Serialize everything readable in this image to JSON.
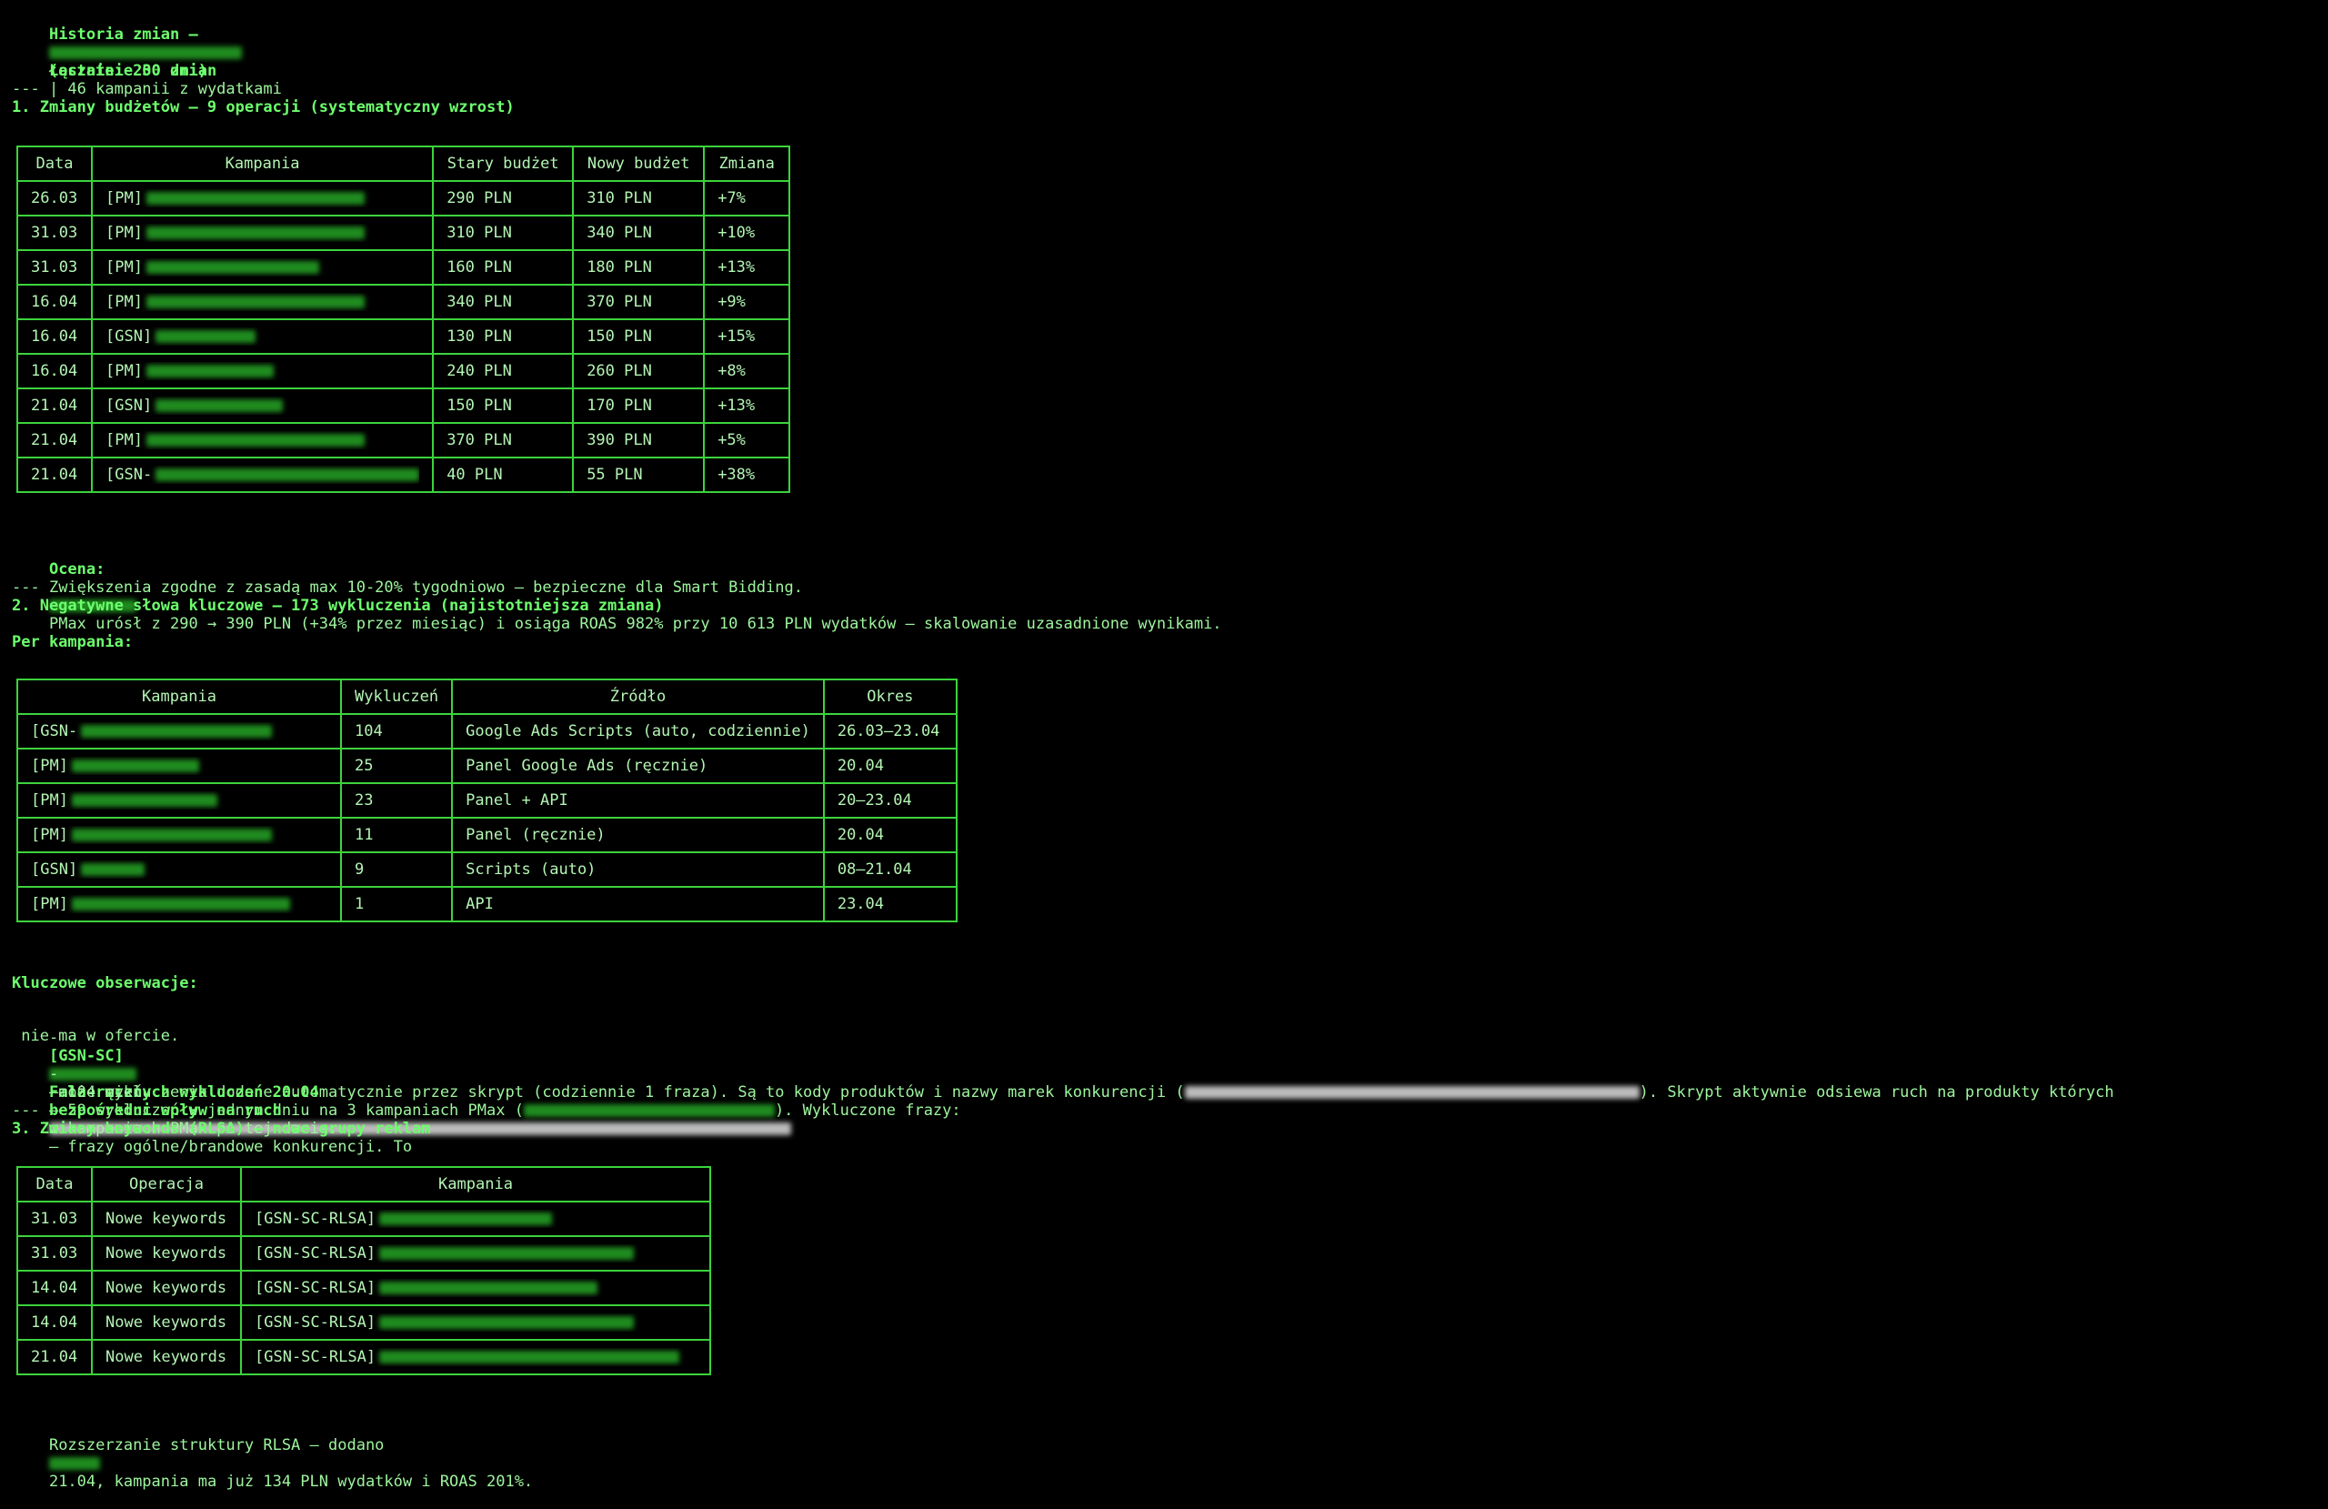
{
  "header": {
    "title_prefix": "Historia zmian —",
    "title_suffix": "(ostatnie 30 dni)",
    "total_label": "Łącznie: 200 zmian",
    "total_rest": "| 46 kampanii z wydatkami",
    "separator": "---"
  },
  "section1": {
    "heading": "1. Zmiany budżetów — 9 operacji (systematyczny wzrost)",
    "columns": [
      "Data",
      "Kampania",
      "Stary budżet",
      "Nowy budżet",
      "Zmiana"
    ],
    "rows": [
      {
        "date": "26.03",
        "prefix": "[PM]",
        "old": "290 PLN",
        "new": "310 PLN",
        "change": "+7%"
      },
      {
        "date": "31.03",
        "prefix": "[PM]",
        "old": "310 PLN",
        "new": "340 PLN",
        "change": "+10%"
      },
      {
        "date": "31.03",
        "prefix": "[PM]",
        "old": "160 PLN",
        "new": "180 PLN",
        "change": "+13%"
      },
      {
        "date": "16.04",
        "prefix": "[PM]",
        "old": "340 PLN",
        "new": "370 PLN",
        "change": "+9%"
      },
      {
        "date": "16.04",
        "prefix": "[GSN]",
        "old": "130 PLN",
        "new": "150 PLN",
        "change": "+15%"
      },
      {
        "date": "16.04",
        "prefix": "[PM]",
        "old": "240 PLN",
        "new": "260 PLN",
        "change": "+8%"
      },
      {
        "date": "21.04",
        "prefix": "[GSN]",
        "old": "150 PLN",
        "new": "170 PLN",
        "change": "+13%"
      },
      {
        "date": "21.04",
        "prefix": "[PM]",
        "old": "370 PLN",
        "new": "390 PLN",
        "change": "+5%"
      },
      {
        "date": "21.04",
        "prefix": "[GSN-",
        "old": "40 PLN",
        "new": "55 PLN",
        "change": "+38%"
      }
    ],
    "assessment_label": "Ocena:",
    "assessment_text_1": "Zwiększenia zgodne z zasadą max 10-20% tygodniowo — bezpieczne dla Smart Bidding.",
    "assessment_text_2": "PMax urósł z 290 → 390 PLN (+34% przez miesiąc) i osiąga ROAS 982% przy 10 613 PLN wydatków — skalowanie uzasadnione wynikami.",
    "separator": "---"
  },
  "section2": {
    "heading": "2. Negatywne słowa kluczowe — 173 wykluczenia (najistotniejsza zmiana)",
    "per_campaign": "Per kampania:",
    "columns": [
      "Kampania",
      "Wykluczeń",
      "Źródło",
      "Okres"
    ],
    "rows": [
      {
        "prefix": "[GSN-",
        "count": "104",
        "source": "Google Ads Scripts (auto, codziennie)",
        "period": "26.03–23.04"
      },
      {
        "prefix": "[PM]",
        "count": "25",
        "source": "Panel Google Ads (ręcznie)",
        "period": "20.04"
      },
      {
        "prefix": "[PM]",
        "count": "23",
        "source": "Panel + API",
        "period": "20–23.04"
      },
      {
        "prefix": "[PM]",
        "count": "11",
        "source": "Panel (ręcznie)",
        "period": "20.04"
      },
      {
        "prefix": "[GSN]",
        "count": "9",
        "source": "Scripts (auto)",
        "period": "08–21.04"
      },
      {
        "prefix": "[PM]",
        "count": "1",
        "source": "API",
        "period": "23.04"
      }
    ],
    "observations_heading": "Kluczowe obserwacje:",
    "obs1_dash": "-",
    "obs1_tag": "[GSN-SC]",
    "obs1_text": "— 104 wykluczenia dodane automatycznie przez skrypt (codziennie 1 fraza). Są to kody produktów i nazwy marek konkurencji (",
    "obs1_text_2": "). Skrypt aktywnie odsiewa ruch na produkty których",
    "obs1_cont": " nie ma w ofercie.",
    "obs2_dash": "-",
    "obs2_bold": "Fala ręcznych wykluczeń 20.04",
    "obs2_text": "— 59 wykluczeń w jednym dniu na 3 kampaniach PMax (",
    "obs2_text_2": "). Wykluczone frazy:",
    "obs2_text_3": "— frazy ogólne/brandowe konkurencji. To",
    "obs2_cont_1": " może mieć",
    "obs2_cont_bold": "bezpośredni wpływ na ruch",
    "obs2_cont_2": "w kampaniach PMax po tej dacie.",
    "separator": "---"
  },
  "section3": {
    "heading": "3. Zmiany keywords (RLSA) — nowe grupy reklam",
    "columns": [
      "Data",
      "Operacja",
      "Kampania"
    ],
    "rows": [
      {
        "date": "31.03",
        "op": "Nowe keywords",
        "prefix": "[GSN-SC-RLSA]"
      },
      {
        "date": "31.03",
        "op": "Nowe keywords",
        "prefix": "[GSN-SC-RLSA]"
      },
      {
        "date": "14.04",
        "op": "Nowe keywords",
        "prefix": "[GSN-SC-RLSA]"
      },
      {
        "date": "14.04",
        "op": "Nowe keywords",
        "prefix": "[GSN-SC-RLSA]"
      },
      {
        "date": "21.04",
        "op": "Nowe keywords",
        "prefix": "[GSN-SC-RLSA]"
      }
    ],
    "footer_1": "Rozszerzanie struktury RLSA — dodano",
    "footer_2": "21.04, kampania ma już 134 PLN wydatków i ROAS 201%."
  },
  "colors": {
    "background": "#000000",
    "text": "#9ef59e",
    "heading": "#6dff6d",
    "border": "#3cd33c"
  }
}
